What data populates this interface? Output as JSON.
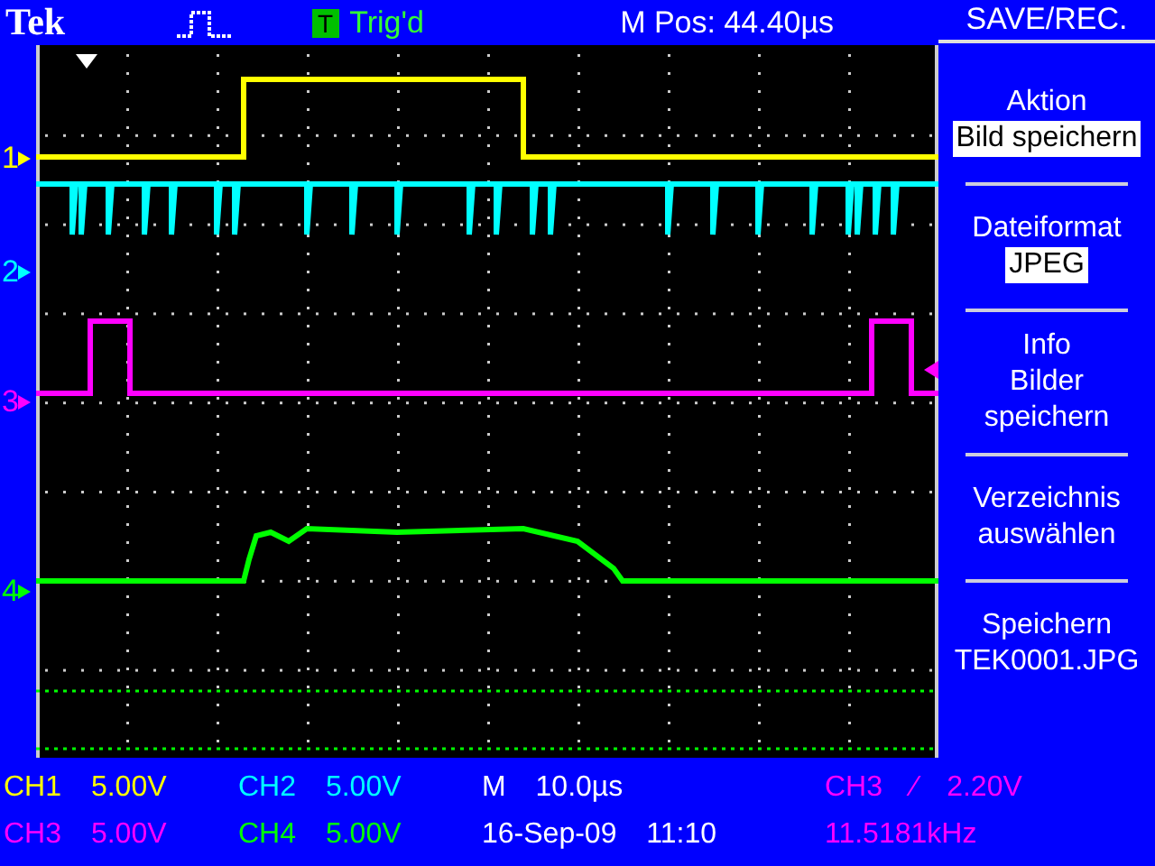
{
  "top_bar": {
    "brand": "Tek",
    "trigger_badge": "T",
    "trigger_status": "Trig'd",
    "position": "M Pos: 44.40µs",
    "menu_title": "SAVE/REC."
  },
  "channels": [
    {
      "label": "1",
      "color": "#ffff00"
    },
    {
      "label": "2",
      "color": "#00ffff"
    },
    {
      "label": "3",
      "color": "#ff00ff"
    },
    {
      "label": "4",
      "color": "#00ff00"
    }
  ],
  "menu": [
    {
      "kind": "setting",
      "title": "Aktion",
      "value": "Bild speichern"
    },
    {
      "kind": "setting",
      "title": "Dateiformat",
      "value": "JPEG"
    },
    {
      "kind": "action",
      "lines": [
        "Info",
        "Bilder",
        "speichern"
      ]
    },
    {
      "kind": "action",
      "lines": [
        "Verzeichnis",
        "auswählen"
      ]
    },
    {
      "kind": "action",
      "lines": [
        "Speichern",
        "TEK0001.JPG"
      ]
    }
  ],
  "readouts": [
    [
      {
        "label": "CH1",
        "value": "5.00V",
        "color": "#ffff00"
      },
      {
        "label": "CH2",
        "value": "5.00V",
        "color": "#00ffff"
      },
      {
        "label": "M 10.0µs",
        "color": "#ffffff"
      },
      {
        "label": "CH3 ⁄ 2.20V",
        "color": "#ff00ff"
      }
    ],
    [
      {
        "label": "CH3",
        "value": "5.00V",
        "color": "#ff00ff"
      },
      {
        "label": "CH4",
        "value": "5.00V",
        "color": "#00ff00"
      },
      {
        "label": "16-Sep-09 11:10",
        "color": "#ffffff"
      },
      {
        "label": "11.5181kHz",
        "color": "#ff00ff"
      }
    ]
  ]
}
